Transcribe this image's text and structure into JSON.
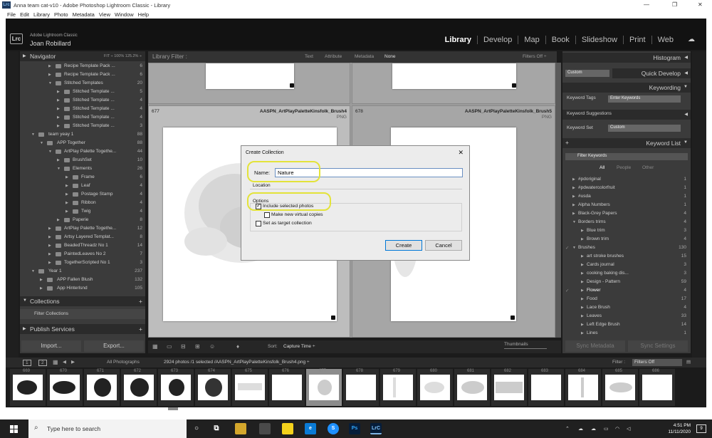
{
  "window": {
    "title": "Anna team cat-v10 - Adobe Photoshop Lightroom Classic - Library",
    "icon_label": "Lrc",
    "controls": [
      "—",
      "❐",
      "✕"
    ]
  },
  "menubar": [
    "File",
    "Edit",
    "Library",
    "Photo",
    "Metadata",
    "View",
    "Window",
    "Help"
  ],
  "identity": {
    "badge": "Lrc",
    "product": "Adobe Lightroom Classic",
    "user": "Joan Robillard"
  },
  "modules": [
    "Library",
    "Develop",
    "Map",
    "Book",
    "Slideshow",
    "Print",
    "Web"
  ],
  "navigator": {
    "title": "Navigator",
    "zoom": "FIT ÷   100%   125.2% ÷"
  },
  "collection_tree": [
    {
      "name": "Recipe Template Pack ...",
      "count": "6"
    },
    {
      "name": "Recipe Template Pack ...",
      "count": "6"
    },
    {
      "name": "Stitched Templates",
      "count": "20"
    },
    {
      "name": "Stitched Template ...",
      "count": "5"
    },
    {
      "name": "Stitched Template ...",
      "count": "4"
    },
    {
      "name": "Stitched Template ...",
      "count": "4"
    },
    {
      "name": "Stitched Template ...",
      "count": "4"
    },
    {
      "name": "Stitched Template ...",
      "count": "3"
    },
    {
      "name": "team yeay 1",
      "count": "88"
    },
    {
      "name": "APP Together",
      "count": "88"
    },
    {
      "name": "ArtPlay Palette Togethe...",
      "count": "44"
    },
    {
      "name": "BrushSet",
      "count": "10"
    },
    {
      "name": "Elements",
      "count": "26"
    },
    {
      "name": "Frame",
      "count": "6"
    },
    {
      "name": "Leaf",
      "count": "4"
    },
    {
      "name": "Postage Stamp",
      "count": "4"
    },
    {
      "name": "Ribbon",
      "count": "4"
    },
    {
      "name": "Twig",
      "count": "4"
    },
    {
      "name": "Paperie",
      "count": "8"
    },
    {
      "name": "ArtPlay Palette Togethe...",
      "count": "12"
    },
    {
      "name": "Artsy Layered Templat...",
      "count": "8"
    },
    {
      "name": "BeadedThreadz No 1",
      "count": "14"
    },
    {
      "name": "PaintedLeaves No 2",
      "count": "7"
    },
    {
      "name": "TogetherScripted No 1",
      "count": "3"
    },
    {
      "name": "Year 1",
      "count": "237"
    },
    {
      "name": "APP Fallen Blush",
      "count": "132"
    },
    {
      "name": "App Hinterlsnd",
      "count": "105"
    }
  ],
  "collections_panel": {
    "title": "Collections",
    "filter": "Filter Collections"
  },
  "publish_panel": {
    "title": "Publish Services"
  },
  "left_buttons": {
    "import": "Import...",
    "export": "Export..."
  },
  "library_filter": {
    "label": "Library Filter :",
    "options": [
      "Text",
      "Attribute",
      "Metadata",
      "None"
    ],
    "status": "Filters Off ÷"
  },
  "grid": {
    "cells": [
      {
        "index": "677",
        "name": "AASPN_ArtPlayPaletteKinsfolk_Brush4",
        "type": "PNG"
      },
      {
        "index": "678",
        "name": "AASPN_ArtPlayPaletteKinsfolk_Brush5",
        "type": "PNG"
      }
    ]
  },
  "toolbar": {
    "sort_label": "Sort:",
    "sort_value": "Capture Time ÷",
    "thumbnails_label": "Thumbnails"
  },
  "right_panel": {
    "histogram": "Histogram",
    "quick_develop": "Quick Develop",
    "quick_develop_preset": "Custom",
    "keywording": "Keywording",
    "keyword_tags_label": "Keyword Tags",
    "keyword_tags_value": "Enter Keywords",
    "keyword_suggestions": "Keyword Suggestions",
    "keyword_set_label": "Keyword Set",
    "keyword_set_value": "Custom",
    "keyword_list": "Keyword List",
    "filter_keywords": "Filter Keywords",
    "kw_tabs": [
      "All",
      "People",
      "Other"
    ],
    "keywords": [
      {
        "name": "#pdoriginal",
        "count": "1"
      },
      {
        "name": "#pdwatercolorfruit",
        "count": "1"
      },
      {
        "name": "#usda",
        "count": "1"
      },
      {
        "name": "Alpha Numbers",
        "count": "1"
      },
      {
        "name": "Black-Grey Papers",
        "count": "4"
      },
      {
        "name": "Borders trims",
        "count": "4"
      },
      {
        "name": "Blue trim",
        "count": "3"
      },
      {
        "name": "Brown trim",
        "count": "4"
      },
      {
        "name": "Brushes",
        "count": "130"
      },
      {
        "name": "art stroke brushes",
        "count": "15"
      },
      {
        "name": "Cards journal",
        "count": "3"
      },
      {
        "name": "cooking baking dis...",
        "count": "3"
      },
      {
        "name": "Design - Pattern",
        "count": "59"
      },
      {
        "name": "Flower",
        "count": "4"
      },
      {
        "name": "Food",
        "count": "17"
      },
      {
        "name": "Lace Brush",
        "count": "4"
      },
      {
        "name": "Leaves",
        "count": "33"
      },
      {
        "name": "Left Edge Brush",
        "count": "14"
      },
      {
        "name": "Lines",
        "count": "1"
      }
    ],
    "sync_metadata": "Sync Metadata",
    "sync_settings": "Sync Settings"
  },
  "filmstrip_bar": {
    "pages": [
      "1",
      "2"
    ],
    "source": "All Photographs",
    "status": "2924 photos /1 selected /AASPN_ArtPlayPaletteKinsfolk_Brush4.png ÷",
    "filter_label": "Filter :",
    "filter_value": "Filters Off"
  },
  "filmstrip": [
    "669",
    "670",
    "671",
    "672",
    "673",
    "674",
    "675",
    "676",
    "677",
    "678",
    "679",
    "680",
    "681",
    "682",
    "683",
    "684",
    "685",
    "686"
  ],
  "dialog": {
    "title": "Create Collection",
    "name_label": "Name:",
    "name_value": "Nature",
    "location_label": "Location",
    "options_label": "Options",
    "include_selected": "Include selected photos",
    "make_virtual": "Make new virtual copies",
    "set_target": "Set as target collection",
    "create": "Create",
    "cancel": "Cancel",
    "close": "✕"
  },
  "taskbar": {
    "search_placeholder": "Type here to search",
    "time": "4:51 PM",
    "date": "11/11/2020",
    "notification_count": "9"
  }
}
